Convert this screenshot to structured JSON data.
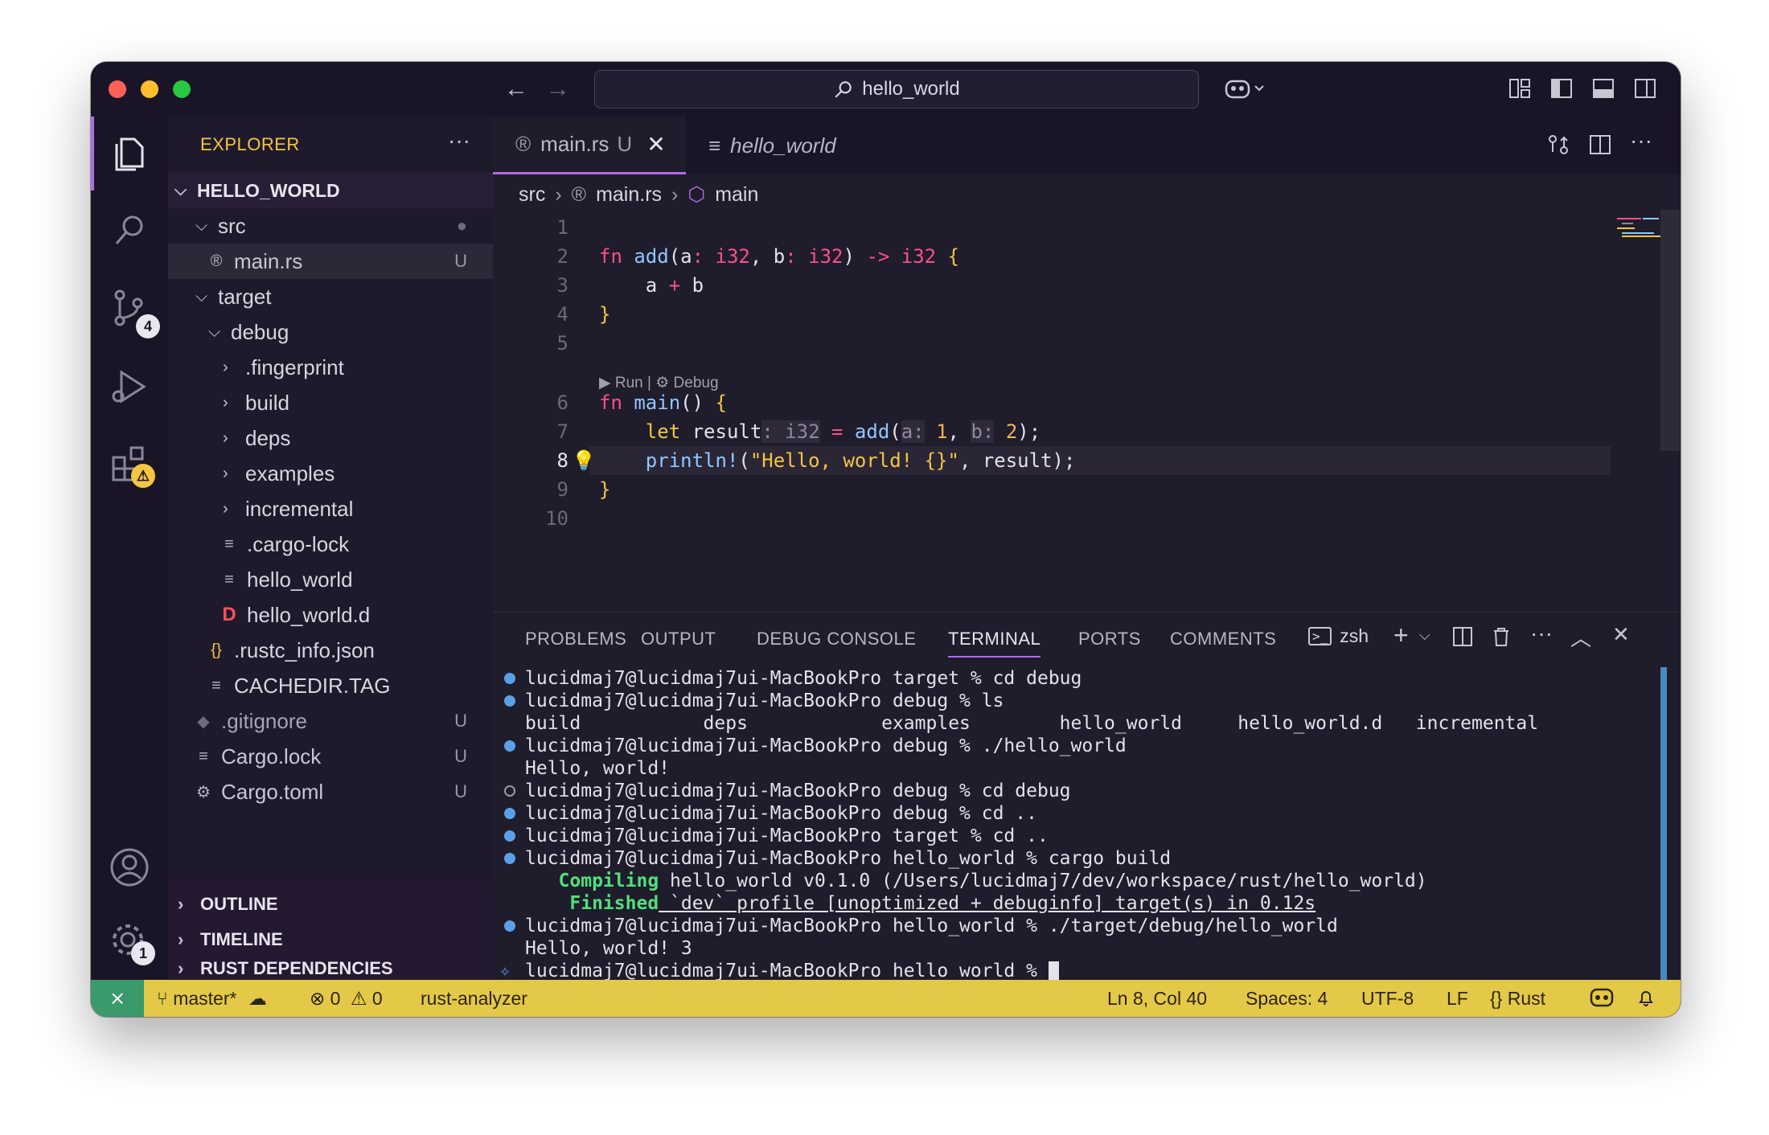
{
  "titlebar": {
    "search_label": "hello_world"
  },
  "activity": {
    "scm_badge": "4",
    "settings_badge": "1"
  },
  "sidebar": {
    "header": "EXPLORER",
    "more": "···",
    "root": "HELLO_WORLD",
    "tree": [
      {
        "label": "src",
        "status": "●"
      },
      {
        "label": "main.rs",
        "status": "U"
      },
      {
        "label": "target",
        "status": ""
      },
      {
        "label": "debug",
        "status": ""
      },
      {
        "label": ".fingerprint",
        "status": ""
      },
      {
        "label": "build",
        "status": ""
      },
      {
        "label": "deps",
        "status": ""
      },
      {
        "label": "examples",
        "status": ""
      },
      {
        "label": "incremental",
        "status": ""
      },
      {
        "label": ".cargo-lock",
        "status": ""
      },
      {
        "label": "hello_world",
        "status": ""
      },
      {
        "label": "hello_world.d",
        "status": ""
      },
      {
        "label": ".rustc_info.json",
        "status": ""
      },
      {
        "label": "CACHEDIR.TAG",
        "status": ""
      },
      {
        "label": ".gitignore",
        "status": "U"
      },
      {
        "label": "Cargo.lock",
        "status": "U"
      },
      {
        "label": "Cargo.toml",
        "status": "U"
      }
    ],
    "sections": [
      "OUTLINE",
      "TIMELINE",
      "RUST DEPENDENCIES"
    ]
  },
  "editor": {
    "tabs": [
      {
        "label": "main.rs",
        "status": "U"
      },
      {
        "label": "hello_world"
      }
    ],
    "breadcrumb": [
      "src",
      "main.rs",
      "main"
    ],
    "codelens": "▶ Run | ⚙ Debug",
    "line_numbers": [
      "1",
      "2",
      "3",
      "4",
      "5",
      "6",
      "7",
      "8",
      "9",
      "10"
    ]
  },
  "panel": {
    "tabs": [
      "PROBLEMS",
      "OUTPUT",
      "DEBUG CONSOLE",
      "TERMINAL",
      "PORTS",
      "COMMENTS"
    ],
    "shell": "zsh",
    "terminal": [
      "lucidmaj7@lucidmaj7ui-MacBookPro target % cd debug",
      "lucidmaj7@lucidmaj7ui-MacBookPro debug % ls",
      "build           deps            examples        hello_world     hello_world.d   incremental",
      "lucidmaj7@lucidmaj7ui-MacBookPro debug % ./hello_world",
      "Hello, world!",
      "lucidmaj7@lucidmaj7ui-MacBookPro debug % cd debug",
      "lucidmaj7@lucidmaj7ui-MacBookPro debug % cd ..",
      "lucidmaj7@lucidmaj7ui-MacBookPro target % cd ..",
      "lucidmaj7@lucidmaj7ui-MacBookPro hello_world % cargo build",
      "Compiling",
      " hello_world v0.1.0 (/Users/lucidmaj7/dev/workspace/rust/hello_world)",
      "Finished",
      " `dev` profile [unoptimized + debuginfo] target(s) in 0.12s",
      "lucidmaj7@lucidmaj7ui-MacBookPro hello_world % ./target/debug/hello_world",
      "Hello, world! 3",
      "lucidmaj7@lucidmaj7ui-MacBookPro hello_world % "
    ]
  },
  "statusbar": {
    "branch": "master*",
    "errors": "0",
    "warnings": "0",
    "language_server": "rust-analyzer",
    "position": "Ln 8, Col 40",
    "spaces": "Spaces: 4",
    "encoding": "UTF-8",
    "eol": "LF",
    "language": "Rust"
  },
  "colors": {
    "accent": "#b06ce6",
    "statusbar": "#e4c847",
    "folder_header": "#f4c542"
  }
}
